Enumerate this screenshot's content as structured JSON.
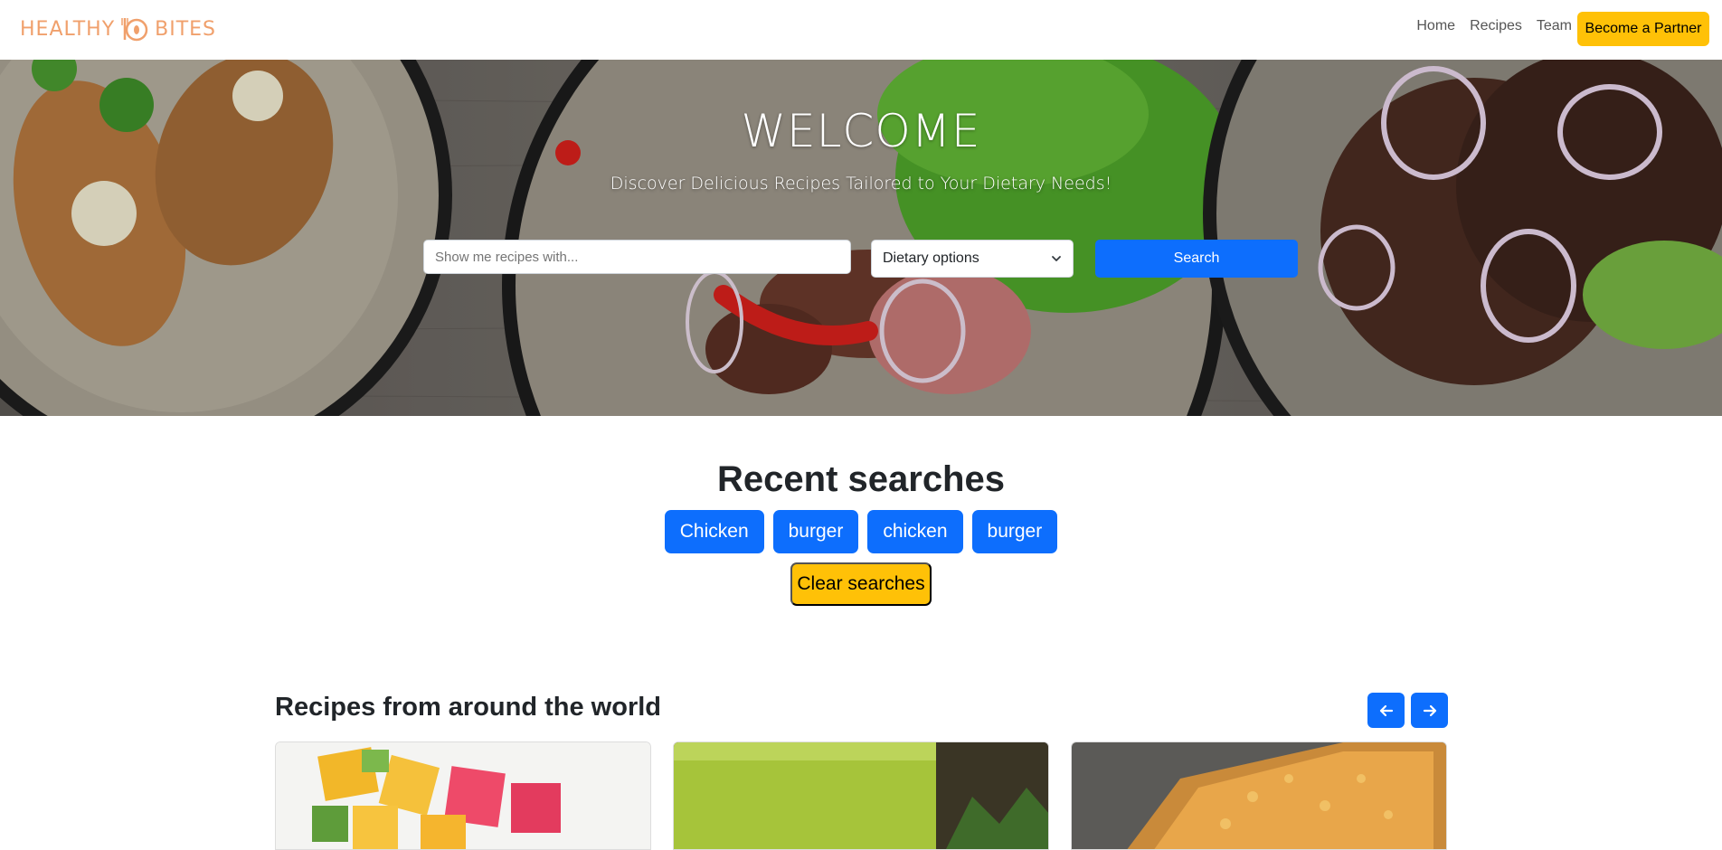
{
  "brand": {
    "name_left": "HEALTHY",
    "name_right": "BITES"
  },
  "nav": {
    "links": [
      "Home",
      "Recipes",
      "Team"
    ],
    "partner_button": "Become a Partner"
  },
  "hero": {
    "title": "WELCOME",
    "subtitle": "Discover Delicious Recipes Tailored to Your Dietary Needs!",
    "search_placeholder": "Show me recipes with...",
    "dietary_select": "Dietary options",
    "search_button": "Search"
  },
  "recent": {
    "title": "Recent searches",
    "chips": [
      "Chicken",
      "burger",
      "chicken",
      "burger"
    ],
    "clear_button": "Clear searches"
  },
  "recipes": {
    "title": "Recipes from around the world"
  },
  "colors": {
    "primary": "#0d6efd",
    "warning": "#ffc107",
    "brand": "#f0a06c"
  },
  "icons": [
    "logo-icon",
    "chevron-down-icon",
    "arrow-left-icon",
    "arrow-right-icon"
  ]
}
